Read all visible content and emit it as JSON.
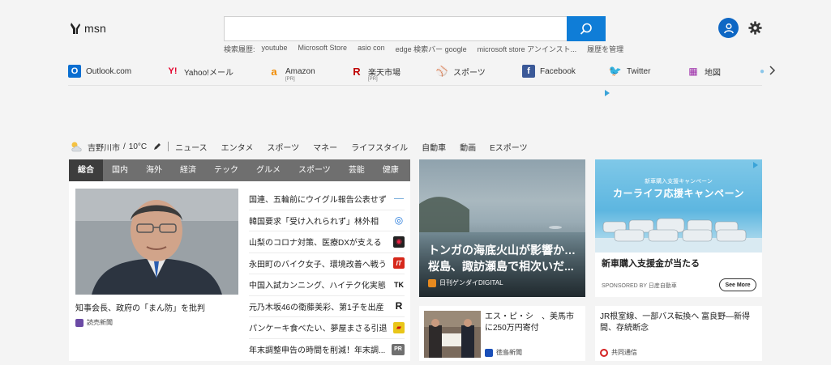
{
  "header": {
    "logo_text": "msn",
    "search_value": "",
    "history_label": "検索履歴:",
    "history_items": [
      "youtube",
      "Microsoft Store",
      "asio con",
      "edge 検索バー google",
      "microsoft store アンインスト...",
      "履歴を管理"
    ]
  },
  "quick_links": [
    {
      "label": "Outlook.com",
      "icon": "outlook-icon",
      "pr": ""
    },
    {
      "label": "Yahoo!メール",
      "icon": "yahoo-icon",
      "pr": ""
    },
    {
      "label": "Amazon",
      "icon": "amazon-icon",
      "pr": "[PR]"
    },
    {
      "label": "楽天市場",
      "icon": "rakuten-icon",
      "pr": "[PR]"
    },
    {
      "label": "スポーツ",
      "icon": "sports-icon",
      "pr": ""
    },
    {
      "label": "Facebook",
      "icon": "facebook-icon",
      "pr": ""
    },
    {
      "label": "Twitter",
      "icon": "twitter-icon",
      "pr": ""
    },
    {
      "label": "地図",
      "icon": "map-icon",
      "pr": ""
    }
  ],
  "weather": {
    "location": "吉野川市",
    "temp": "10°C"
  },
  "categories": [
    "ニュース",
    "エンタメ",
    "スポーツ",
    "マネー",
    "ライフスタイル",
    "自動車",
    "動画",
    "Eスポーツ"
  ],
  "news_tabs": [
    "総合",
    "国内",
    "海外",
    "経済",
    "テック",
    "グルメ",
    "スポーツ",
    "芸能",
    "健康"
  ],
  "hero": {
    "caption": "知事会長、政府の「まん防」を批判",
    "source": "読売新聞"
  },
  "news_list": [
    {
      "title": "国連、五輪前にウイグル報告公表せず",
      "badge": "——"
    },
    {
      "title": "韓国要求「受け入れられず」林外相",
      "badge": "◎"
    },
    {
      "title": "山梨のコロナ対策、医療DXが支える",
      "badge": "◉"
    },
    {
      "title": "永田町のバイク女子、環境改善へ戦う",
      "badge": "IT"
    },
    {
      "title": "中国入試カンニング、ハイテク化実態",
      "badge": "TK"
    },
    {
      "title": "元乃木坂46の衛藤美彩、第1子を出産",
      "badge": "R"
    },
    {
      "title": "パンケーキ食べたい、夢屋まさる引退",
      "badge": "▰"
    },
    {
      "title": "年末調整申告の時間を削減！年末調...",
      "badge": "PR"
    }
  ],
  "featured": {
    "title": "トンガの海底火山が影響か… 桜島、諏訪瀬島で相次いだ...",
    "source": "日刊ゲンダイDIGITAL"
  },
  "ad": {
    "kicker": "新車購入支援キャンペーン",
    "headline": "カーライフ応援キャンペーン",
    "title": "新車購入支援金が当たる",
    "sponsor": "SPONSORED BY 日産自動車",
    "cta": "See More"
  },
  "card_bottom_1": {
    "title_line1": "エス・ピ・シ　、美馬市",
    "title_line2": "に250万円寄付",
    "source": "徳島新聞"
  },
  "card_bottom_2": {
    "title": "JR根室線、一部バス転換へ 富良野—新得間、存続断念",
    "source": "共同通信"
  },
  "colors": {
    "accent": "#0f7dd7",
    "tab_bar": "#6f6f6f",
    "tab_active": "#3d3d3d"
  }
}
